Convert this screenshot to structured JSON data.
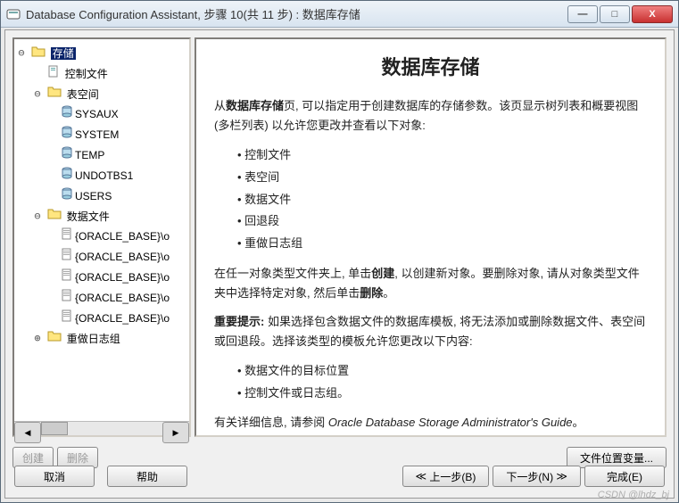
{
  "window": {
    "title": "Database Configuration Assistant, 步骤 10(共 11 步) : 数据库存储",
    "min": "—",
    "max": "□",
    "close": "X"
  },
  "tree": {
    "root": "存储",
    "controlFiles": "控制文件",
    "tablespaces": "表空间",
    "ts_items": [
      "SYSAUX",
      "SYSTEM",
      "TEMP",
      "UNDOTBS1",
      "USERS"
    ],
    "datafiles": "数据文件",
    "df_items": [
      "{ORACLE_BASE}\\o",
      "{ORACLE_BASE}\\o",
      "{ORACLE_BASE}\\o",
      "{ORACLE_BASE}\\o",
      "{ORACLE_BASE}\\o"
    ],
    "redo": "重做日志组"
  },
  "content": {
    "heading": "数据库存储",
    "p1a": "从",
    "p1b": "数据库存储",
    "p1c": "页, 可以指定用于创建数据库的存储参数。该页显示树列表和概要视图 (多栏列表) 以允许您更改并查看以下对象:",
    "list1": [
      "控制文件",
      "表空间",
      "数据文件",
      "回退段",
      "重做日志组"
    ],
    "p2a": "在任一对象类型文件夹上, 单击",
    "p2b": "创建",
    "p2c": ", 以创建新对象。要删除对象, 请从对象类型文件夹中选择特定对象, 然后单击",
    "p2d": "删除",
    "p2e": "。",
    "p3a": "重要提示:",
    "p3b": " 如果选择包含数据文件的数据库模板, 将无法添加或删除数据文件、表空间或回退段。选择该类型的模板允许您更改以下内容:",
    "list2": [
      "数据文件的目标位置",
      "控制文件或日志组。"
    ],
    "p4a": "有关详细信息, 请参阅 ",
    "p4b": "Oracle Database Storage Administrator's Guide",
    "p4c": "。"
  },
  "buttons": {
    "create": "创建",
    "delete": "删除",
    "fileLoc": "文件位置变量...",
    "cancel": "取消",
    "help": "帮助",
    "back": "上一步(B)",
    "next": "下一步(N)",
    "finish": "完成(E)"
  },
  "watermark": "CSDN @lhdz_bj"
}
